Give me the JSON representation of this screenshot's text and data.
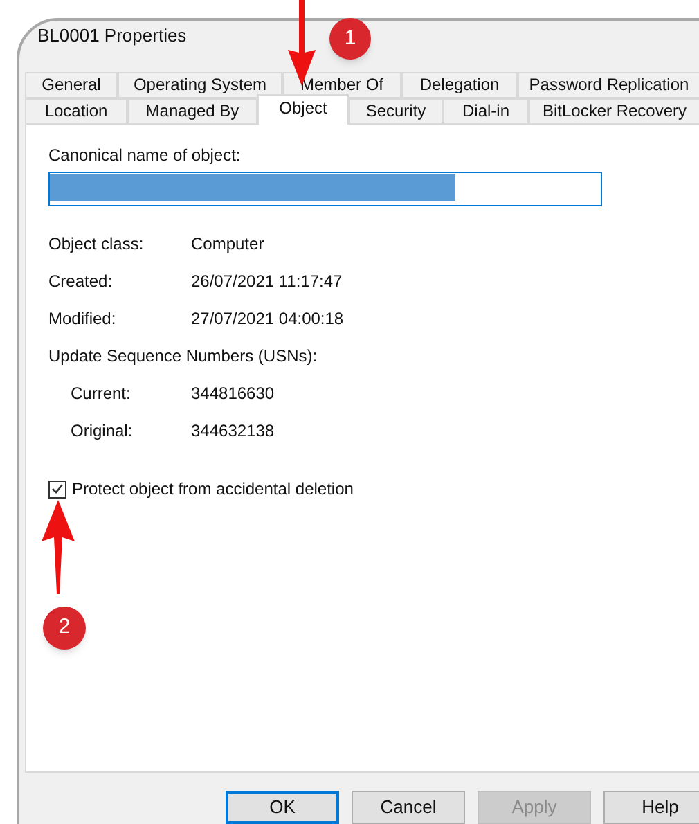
{
  "window": {
    "title": "BL0001 Properties"
  },
  "tab_rows": [
    {
      "tabs": [
        {
          "label": "General",
          "selected": false
        },
        {
          "label": "Operating System",
          "selected": false
        },
        {
          "label": "Member Of",
          "selected": false
        },
        {
          "label": "Delegation",
          "selected": false
        },
        {
          "label": "Password Replication",
          "selected": false
        }
      ]
    },
    {
      "tabs": [
        {
          "label": "Location",
          "selected": false
        },
        {
          "label": "Managed By",
          "selected": false
        },
        {
          "label": "Object",
          "selected": true
        },
        {
          "label": "Security",
          "selected": false
        },
        {
          "label": "Dial-in",
          "selected": false
        },
        {
          "label": "BitLocker Recovery",
          "selected": false
        }
      ]
    }
  ],
  "canonical_name": {
    "label": "Canonical name of object:",
    "redacted": true
  },
  "properties": [
    {
      "label": "Object class:",
      "value": "Computer"
    },
    {
      "label": "Created:",
      "value": "26/07/2021 11:17:47"
    },
    {
      "label": "Modified:",
      "value": "27/07/2021 04:00:18"
    }
  ],
  "usn": {
    "heading": "Update Sequence Numbers (USNs):",
    "items": [
      {
        "label": "Current:",
        "value": "344816630"
      },
      {
        "label": "Original:",
        "value": "344632138"
      }
    ]
  },
  "protect_checkbox": {
    "label": "Protect object from accidental deletion",
    "checked": true
  },
  "buttons": [
    {
      "label": "OK",
      "disabled": false,
      "default": true
    },
    {
      "label": "Cancel",
      "disabled": false,
      "default": false
    },
    {
      "label": "Apply",
      "disabled": true,
      "default": false
    },
    {
      "label": "Help",
      "disabled": false,
      "default": false
    }
  ],
  "annotations": [
    {
      "number": "1"
    },
    {
      "number": "2"
    }
  ]
}
